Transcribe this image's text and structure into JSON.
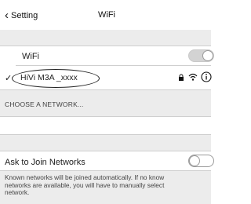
{
  "nav": {
    "back_label": "Setting",
    "title": "WiFi"
  },
  "wifi_row": {
    "label": "WiFi",
    "enabled": true
  },
  "current_network": {
    "name": "HiVi M3A _xxxx",
    "connected": true,
    "icons": [
      "lock-icon",
      "wifi-signal-icon",
      "info-icon"
    ]
  },
  "choose_header": "CHOOSE A NETWORK...",
  "ask_row": {
    "label": "Ask to Join Networks",
    "enabled": false
  },
  "footnote_lines": [
    "Known networks will be joined automatically. If no know",
    "networks are available, you will have to manually select",
    "network."
  ],
  "colors": {
    "band": "#ececec",
    "divider": "#cfcfcf",
    "toggle_on": "#d3d3d3"
  }
}
